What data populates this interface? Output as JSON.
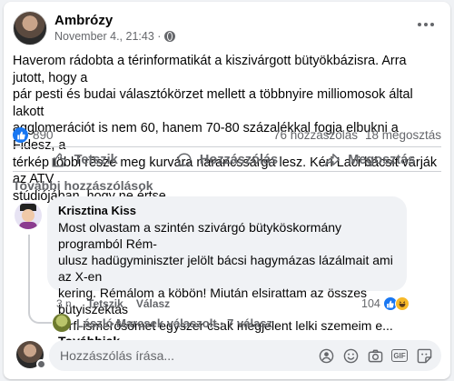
{
  "post": {
    "author": "Ambrózy",
    "meta": "November 4., 21:43 ·",
    "text": "Haverom rádobta a térinformatikát a kiszivárgott bütyökbázisra. Arra jutott, hogy a\npár pesti és budai választókörzet mellett a többnyire milliomosok által lakott\nagglomerációt is nem 60, hanem 70-80 százalékkal fogja elbukni a Fidesz, a\ntérkép többi része meg kurvára narancssárga lesz. Kéri Laci bácsit várják az ATV\nstúdiójában, hogy ne értse."
  },
  "stats": {
    "reactions": "890",
    "comments": "76 hozzászólás",
    "shares": "18 megosztás"
  },
  "actions": {
    "like": "Tetszik",
    "comment": "Hozzászólás",
    "share": "Megosztás"
  },
  "more_comments_label": "További hozzászólások",
  "comment": {
    "author": "Krisztina Kiss",
    "text": "Most olvastam a szintén szivárgó bütyköskormány programból Rém-\nulusz hadügyminiszter jelölt bácsi hagymázas lázálmait ami az X-en\nkering. Rémálom a köbön! Miután elsirattam az összes bütyiszektás\nférfi ismerősömet egyszer csak megjelent lelki szemeim e...",
    "read_more": "Továbbiak",
    "time": "3 n.",
    "like": "Tetszik",
    "reply": "Válasz",
    "reaction_count": "104"
  },
  "reply_summary": "László Marcsek válaszolt · 7 válasz",
  "composer": {
    "placeholder": "Hozzászólás írása..."
  },
  "colors": {
    "accent": "#1877f2",
    "secondary_text": "#65676b",
    "bubble": "#f0f2f5"
  }
}
